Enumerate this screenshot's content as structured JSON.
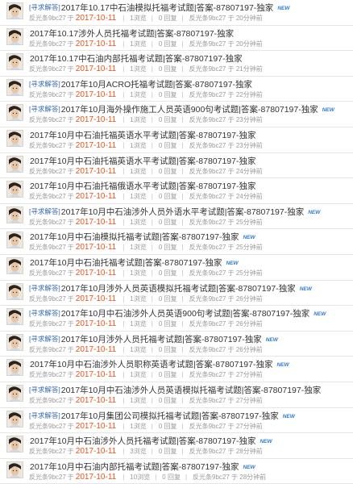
{
  "threads": [
    {
      "tag": "[寻求解答]",
      "title": "2017年10.17中石油模拟托福考试题|答案-87807197-独家",
      "new": "NEW",
      "author": "反光条9bc27",
      "yu": "于",
      "date": "2017-10-11",
      "views": "1浏览",
      "replies": "0 回复",
      "last": "反光条9bc27 于 20分钟前"
    },
    {
      "tag": "",
      "title": "2017年10.17涉外人员托福考试题|答案-87807197-独家",
      "new": "",
      "author": "反光条9bc27",
      "yu": "于",
      "date": "2017-10-11",
      "views": "1浏览",
      "replies": "0 回复",
      "last": "反光条9bc27 于 20分钟前"
    },
    {
      "tag": "",
      "title": "2017年10.17中石油内部托福考试题|答案-87807197-独家",
      "new": "",
      "author": "反光条9bc27",
      "yu": "于",
      "date": "2017-10-11",
      "views": "1浏览",
      "replies": "0 回复",
      "last": "反光条9bc27 于 21分钟前"
    },
    {
      "tag": "[寻求解答]",
      "title": "2017年10月ACRO托福考试题|答案-87807197-独家",
      "new": "",
      "author": "反光条9bc27",
      "yu": "于",
      "date": "2017-10-11",
      "views": "1浏览",
      "replies": "0 回复",
      "last": "反光条9bc27 于 22分钟前"
    },
    {
      "tag": "[寻求解答]",
      "title": "2017年10月海外操作施工人员英语900句考试题|答案-87807197-独家",
      "new": "NEW",
      "author": "反光条9bc27",
      "yu": "于",
      "date": "2017-10-11",
      "views": "1浏览",
      "replies": "0 回复",
      "last": "反光条9bc27 于 23分钟前"
    },
    {
      "tag": "",
      "title": "2017年10月中石油托福英语水平考试题|答案-87807197-独家",
      "new": "",
      "author": "反光条9bc27",
      "yu": "于",
      "date": "2017-10-11",
      "views": "1浏览",
      "replies": "0 回复",
      "last": "反光条9bc27 于 23分钟前"
    },
    {
      "tag": "",
      "title": "2017年10月中石油托福英语水平考试题|答案-87807197-独家",
      "new": "",
      "author": "反光条9bc27",
      "yu": "于",
      "date": "2017-10-11",
      "views": "1浏览",
      "replies": "0 回复",
      "last": "反光条9bc27 于 24分钟前"
    },
    {
      "tag": "",
      "title": "2017年10月中石油托福俄语水平考试题|答案-87807197-独家",
      "new": "",
      "author": "反光条9bc27",
      "yu": "于",
      "date": "2017-10-11",
      "views": "1浏览",
      "replies": "0 回复",
      "last": "反光条9bc27 于 24分钟前"
    },
    {
      "tag": "[寻求解答]",
      "title": "2017年10月中石油涉外人员外语水平考试题|答案-87807197-独家",
      "new": "NEW",
      "author": "反光条9bc27",
      "yu": "于",
      "date": "2017-10-11",
      "views": "1浏览",
      "replies": "0 回复",
      "last": "反光条9bc27 于 25分钟前"
    },
    {
      "tag": "",
      "title": "2017年10月中石油模拟托福考试题|答案-87807197-独家",
      "new": "NEW",
      "author": "反光条9bc27",
      "yu": "于",
      "date": "2017-10-11",
      "views": "1浏览",
      "replies": "0 回复",
      "last": "反光条9bc27 于 25分钟前"
    },
    {
      "tag": "",
      "title": "2017年10月中石油托福考试题|答案-87807197-独家",
      "new": "NEW",
      "author": "反光条9bc27",
      "yu": "于",
      "date": "2017-10-11",
      "views": "1浏览",
      "replies": "0 回复",
      "last": "反光条9bc27 于 25分钟前"
    },
    {
      "tag": "[寻求解答]",
      "title": "2017年10月涉外人员英语模拟托福考试题|答案-87807197-独家",
      "new": "NEW",
      "author": "反光条9bc27",
      "yu": "于",
      "date": "2017-10-11",
      "views": "1浏览",
      "replies": "0 回复",
      "last": "反光条9bc27 于 26分钟前"
    },
    {
      "tag": "[寻求解答]",
      "title": "2017年10月中石油涉外人员英语900句考试题|答案-87807197-独家",
      "new": "NEW",
      "author": "反光条9bc27",
      "yu": "于",
      "date": "2017-10-11",
      "views": "1浏览",
      "replies": "0 回复",
      "last": "反光条9bc27 于 26分钟前"
    },
    {
      "tag": "[寻求解答]",
      "title": "2017年10月涉外人员托福考试题|答案-87807197-独家",
      "new": "NEW",
      "author": "反光条9bc27",
      "yu": "于",
      "date": "2017-10-11",
      "views": "1浏览",
      "replies": "0 回复",
      "last": "反光条9bc27 于 26分钟前"
    },
    {
      "tag": "",
      "title": "2017年10月中石油涉外人员职称英语考试题|答案-87807197-独家",
      "new": "NEW",
      "author": "反光条9bc27",
      "yu": "于",
      "date": "2017-10-11",
      "views": "1浏览",
      "replies": "0 回复",
      "last": "反光条9bc27 于 27分钟前"
    },
    {
      "tag": "[寻求解答]",
      "title": "2017年10月中石油涉外人员英语模拟托福考试题|答案-87807197-独家",
      "new": "",
      "author": "反光条9bc27",
      "yu": "于",
      "date": "2017-10-11",
      "views": "1浏览",
      "replies": "0 回复",
      "last": "反光条9bc27 于 27分钟前"
    },
    {
      "tag": "[寻求解答]",
      "title": "2017年10月集团公司模拟托福考试题|答案-87807197-独家",
      "new": "NEW",
      "author": "反光条9bc27",
      "yu": "于",
      "date": "2017-10-11",
      "views": "1浏览",
      "replies": "0 回复",
      "last": "反光条9bc27 于 27分钟前"
    },
    {
      "tag": "",
      "title": "2017年10月中石油涉外人员托福考试题|答案-87807197-独家",
      "new": "NEW",
      "author": "反光条9bc27",
      "yu": "于",
      "date": "2017-10-11",
      "views": "3浏览",
      "replies": "0 回复",
      "last": "反光条9bc27 于 28分钟前"
    },
    {
      "tag": "",
      "title": "2017年10月中石油内部托福考试题|答案-87807197-独家",
      "new": "NEW",
      "author": "反光条9bc27",
      "yu": "于",
      "date": "2017-10-11",
      "views": "10浏览",
      "replies": "0 回复",
      "last": "反光条9bc27 于 28分钟前"
    }
  ]
}
